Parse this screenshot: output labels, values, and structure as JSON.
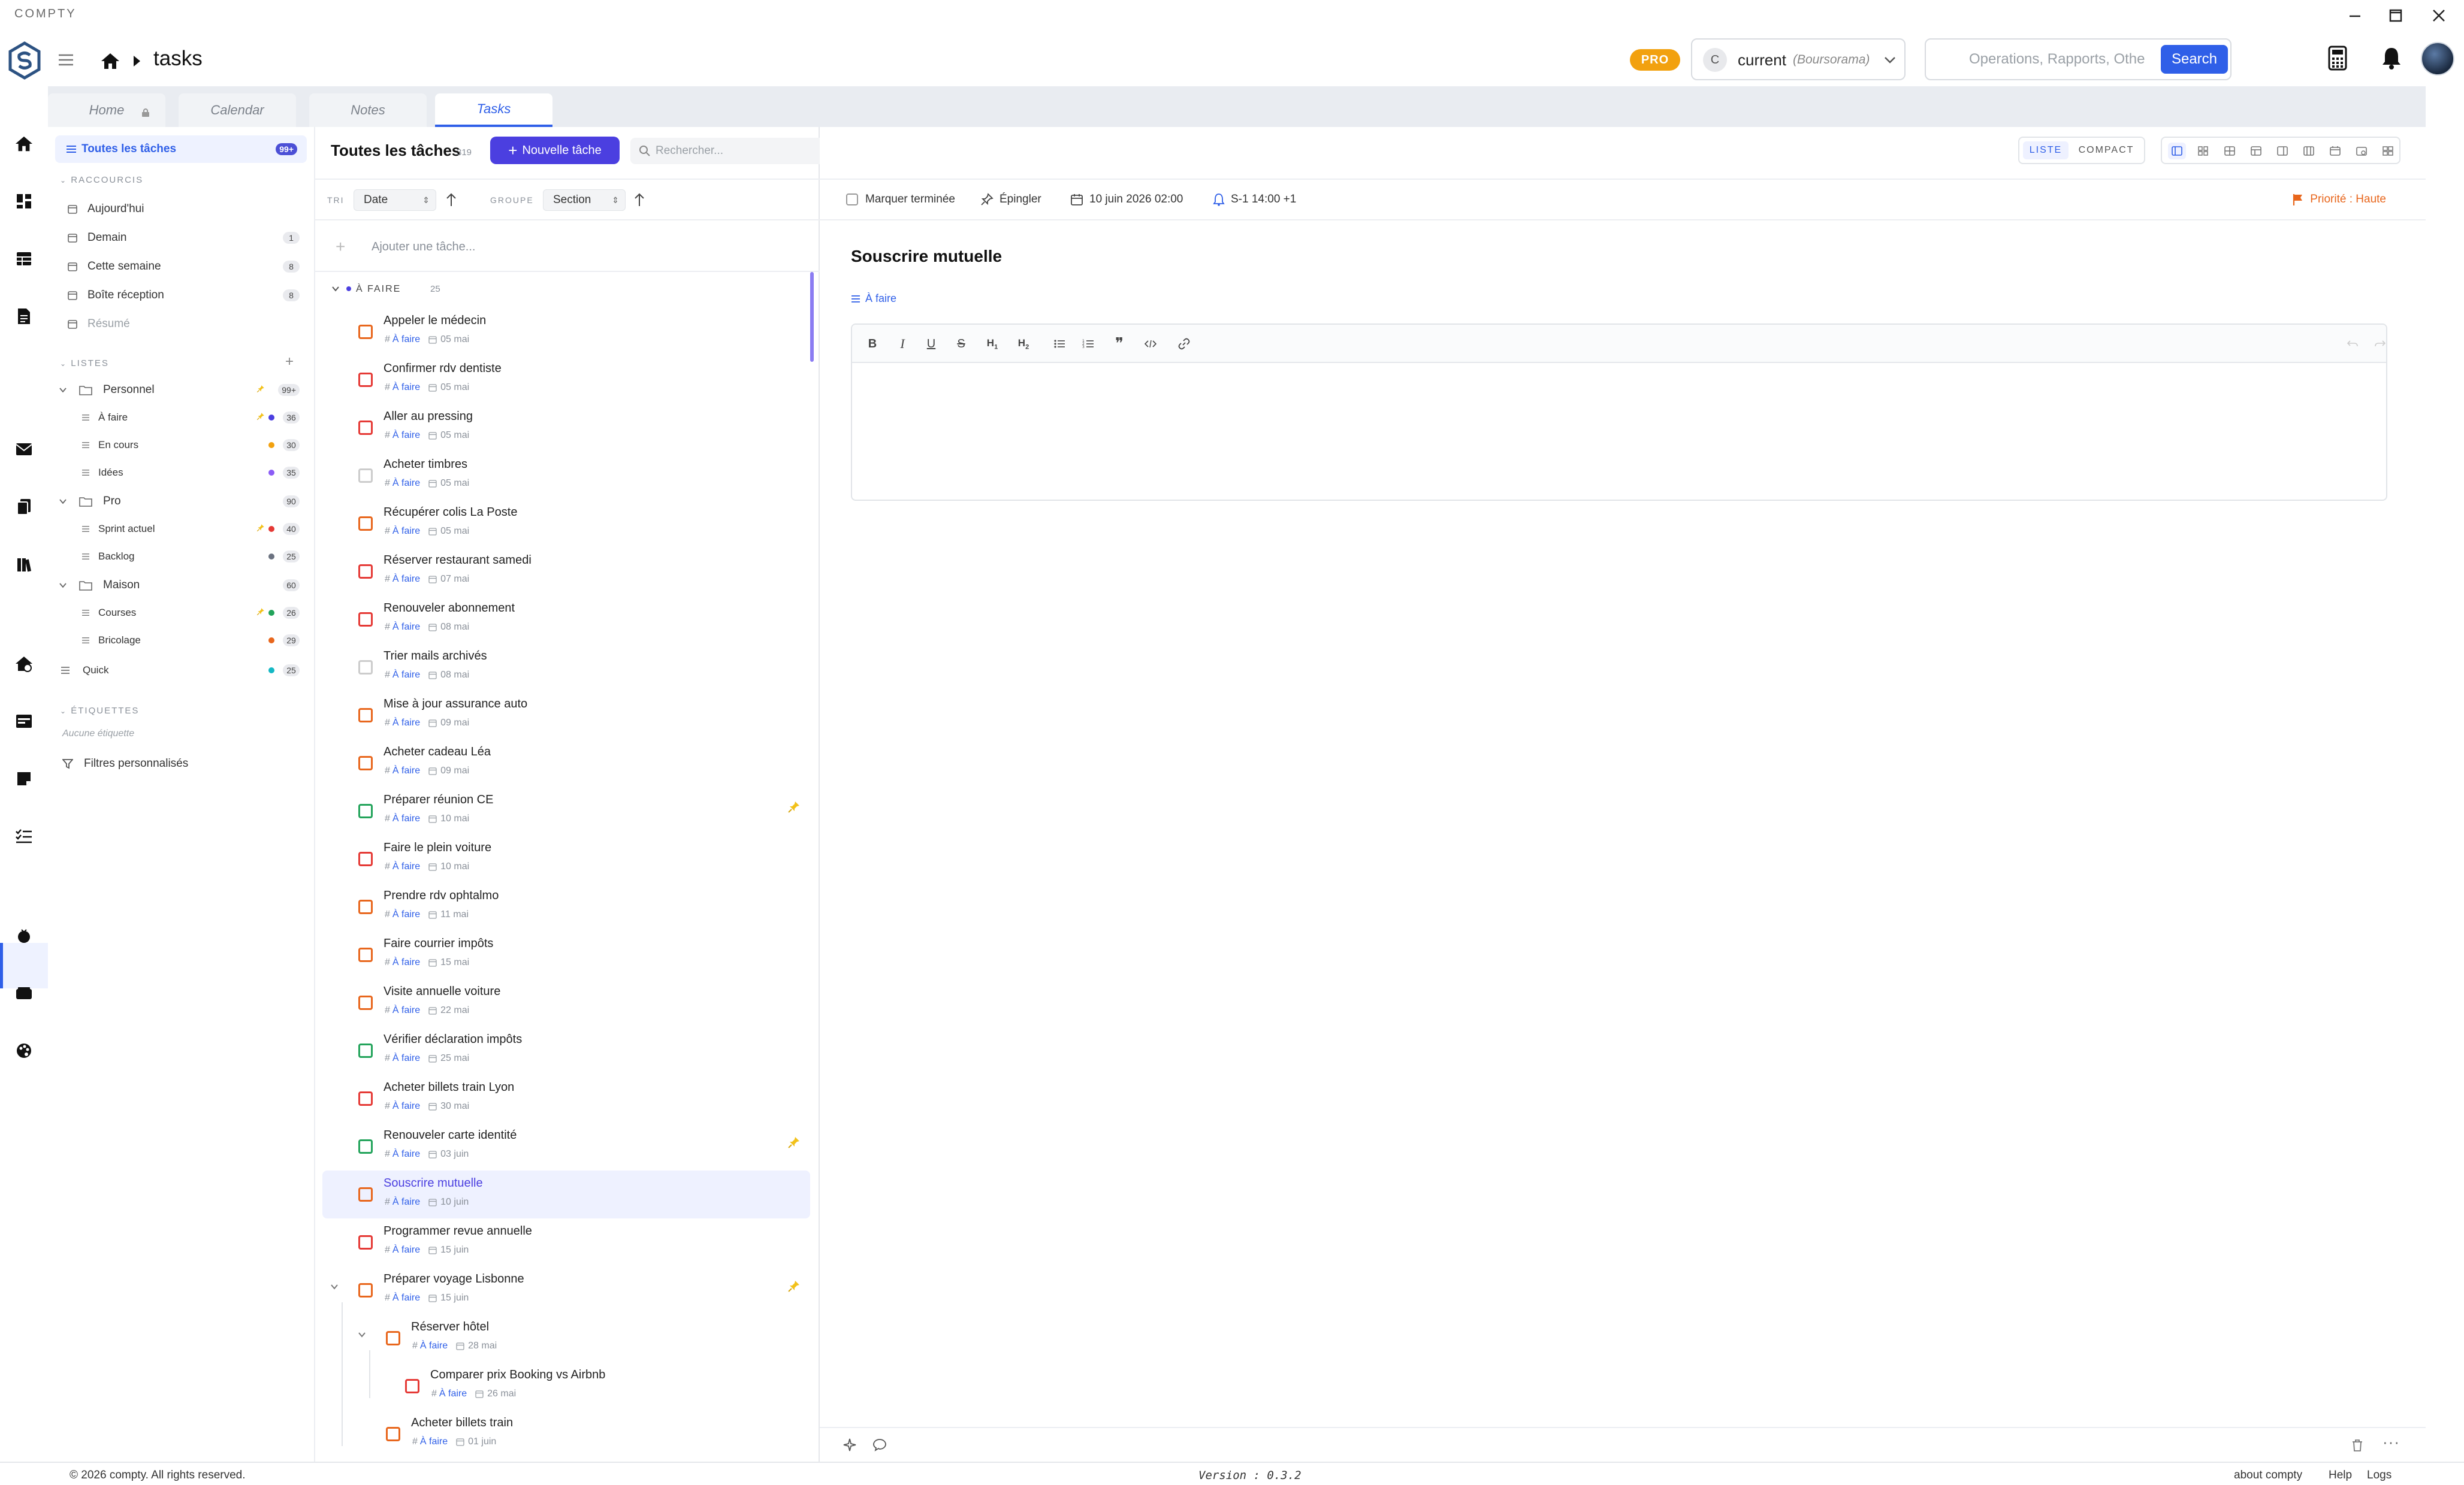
{
  "app": {
    "name": "COMPTY",
    "page_title": "tasks"
  },
  "header": {
    "pro_label": "PRO",
    "account": {
      "initial": "C",
      "name": "current",
      "bank": "(Boursorama)"
    },
    "search": {
      "placeholder": "Operations, Rapports, Othe",
      "button": "Search"
    }
  },
  "tabs": [
    {
      "label": "Home",
      "locked": true
    },
    {
      "label": "Calendar"
    },
    {
      "label": "Notes"
    },
    {
      "label": "Tasks",
      "active": true
    }
  ],
  "sidebar": {
    "all": {
      "label": "Toutes les tâches",
      "count": "99+"
    },
    "shortcuts_heading": "RACCOURCIS",
    "shortcuts": [
      {
        "label": "Aujourd'hui",
        "count": ""
      },
      {
        "label": "Demain",
        "count": "1"
      },
      {
        "label": "Cette semaine",
        "count": "8"
      },
      {
        "label": "Boîte réception",
        "count": "8"
      },
      {
        "label": "Résumé",
        "count": ""
      }
    ],
    "lists_heading": "LISTES",
    "lists": [
      {
        "label": "Personnel",
        "count": "99+",
        "folder": true,
        "pin": true
      },
      {
        "label": "À faire",
        "count": "36",
        "dot": "#4b3fe0",
        "pin": true
      },
      {
        "label": "En cours",
        "count": "30",
        "dot": "#f2a10f"
      },
      {
        "label": "Idées",
        "count": "35",
        "dot": "#8b5cf6"
      },
      {
        "label": "Pro",
        "count": "90",
        "folder": true
      },
      {
        "label": "Sprint actuel",
        "count": "40",
        "dot": "#e53935",
        "pin": true
      },
      {
        "label": "Backlog",
        "count": "25",
        "dot": "#6b7280"
      },
      {
        "label": "Maison",
        "count": "60",
        "folder": true
      },
      {
        "label": "Courses",
        "count": "26",
        "dot": "#22a35a",
        "pin": true
      },
      {
        "label": "Bricolage",
        "count": "29",
        "dot": "#e8661c"
      },
      {
        "label": "Quick",
        "count": "25",
        "dot": "#14b8c4"
      }
    ],
    "tags_heading": "ÉTIQUETTES",
    "no_tags": "Aucune étiquette",
    "custom_filters": "Filtres personnalisés"
  },
  "list": {
    "title": "Toutes les tâches",
    "count": "319",
    "new_task": "Nouvelle tâche",
    "search_placeholder": "Rechercher...",
    "sort_label": "TRI",
    "sort_value": "Date",
    "group_label": "GROUPE",
    "group_value": "Section",
    "add_placeholder": "Ajouter une tâche...",
    "section": {
      "name": "À FAIRE",
      "count": "25"
    },
    "tasks": [
      {
        "title": "Appeler le médecin",
        "section": "À faire",
        "date": "05 mai",
        "prio": "#e8661c"
      },
      {
        "title": "Confirmer rdv dentiste",
        "section": "À faire",
        "date": "05 mai",
        "prio": "#e53935"
      },
      {
        "title": "Aller au pressing",
        "section": "À faire",
        "date": "05 mai",
        "prio": "#e53935"
      },
      {
        "title": "Acheter timbres",
        "section": "À faire",
        "date": "05 mai",
        "prio": "#cccccc"
      },
      {
        "title": "Récupérer colis La Poste",
        "section": "À faire",
        "date": "05 mai",
        "prio": "#e8661c"
      },
      {
        "title": "Réserver restaurant samedi",
        "section": "À faire",
        "date": "07 mai",
        "prio": "#e53935"
      },
      {
        "title": "Renouveler abonnement",
        "section": "À faire",
        "date": "08 mai",
        "prio": "#e53935"
      },
      {
        "title": "Trier mails archivés",
        "section": "À faire",
        "date": "08 mai",
        "prio": "#cccccc"
      },
      {
        "title": "Mise à jour assurance auto",
        "section": "À faire",
        "date": "09 mai",
        "prio": "#e8661c"
      },
      {
        "title": "Acheter cadeau Léa",
        "section": "À faire",
        "date": "09 mai",
        "prio": "#e8661c"
      },
      {
        "title": "Préparer réunion CE",
        "section": "À faire",
        "date": "10 mai",
        "prio": "#22a35a",
        "pin": true
      },
      {
        "title": "Faire le plein voiture",
        "section": "À faire",
        "date": "10 mai",
        "prio": "#e53935"
      },
      {
        "title": "Prendre rdv ophtalmo",
        "section": "À faire",
        "date": "11 mai",
        "prio": "#e8661c"
      },
      {
        "title": "Faire courrier impôts",
        "section": "À faire",
        "date": "15 mai",
        "prio": "#e8661c"
      },
      {
        "title": "Visite annuelle voiture",
        "section": "À faire",
        "date": "22 mai",
        "prio": "#e8661c"
      },
      {
        "title": "Vérifier déclaration impôts",
        "section": "À faire",
        "date": "25 mai",
        "prio": "#22a35a"
      },
      {
        "title": "Acheter billets train Lyon",
        "section": "À faire",
        "date": "30 mai",
        "prio": "#e53935"
      },
      {
        "title": "Renouveler carte identité",
        "section": "À faire",
        "date": "03 juin",
        "prio": "#22a35a",
        "pin": true
      },
      {
        "title": "Souscrire mutuelle",
        "section": "À faire",
        "date": "10 juin",
        "prio": "#e8661c",
        "selected": true
      },
      {
        "title": "Programmer revue annuelle",
        "section": "À faire",
        "date": "15 juin",
        "prio": "#e53935"
      },
      {
        "title": "Préparer voyage Lisbonne",
        "section": "À faire",
        "date": "15 juin",
        "prio": "#e8661c",
        "pin": true,
        "expand": true
      }
    ],
    "subtasks": [
      {
        "title": "Réserver hôtel",
        "section": "À faire",
        "date": "28 mai",
        "prio": "#e8661c",
        "level": 1,
        "expand": true
      },
      {
        "title": "Comparer prix Booking vs Airbnb",
        "section": "À faire",
        "date": "26 mai",
        "prio": "#e53935",
        "level": 2
      },
      {
        "title": "Acheter billets train",
        "section": "À faire",
        "date": "01 juin",
        "prio": "#e8661c",
        "level": 1
      }
    ]
  },
  "detail": {
    "view_list": "LISTE",
    "view_compact": "COMPACT",
    "mark_done": "Marquer terminée",
    "pin": "Épingler",
    "due": "10 juin 2026 02:00",
    "reminder": "S-1 14:00 +1",
    "priority": "Priorité : Haute",
    "title": "Souscrire mutuelle",
    "section": "À faire",
    "editor_tools": [
      "B",
      "I",
      "U",
      "S",
      "H1",
      "H2",
      "ul",
      "ol",
      "quote",
      "code",
      "link"
    ]
  },
  "footer": {
    "copyright": "© 2026 compty. All rights reserved.",
    "version": "Version : 0.3.2",
    "links": [
      "about compty",
      "Help",
      "Logs"
    ]
  },
  "colors": {
    "accent": "#2f5fe8",
    "primary_button": "#4b3fe0",
    "pro": "#f2a10f",
    "priority_high": "#e8661c"
  }
}
